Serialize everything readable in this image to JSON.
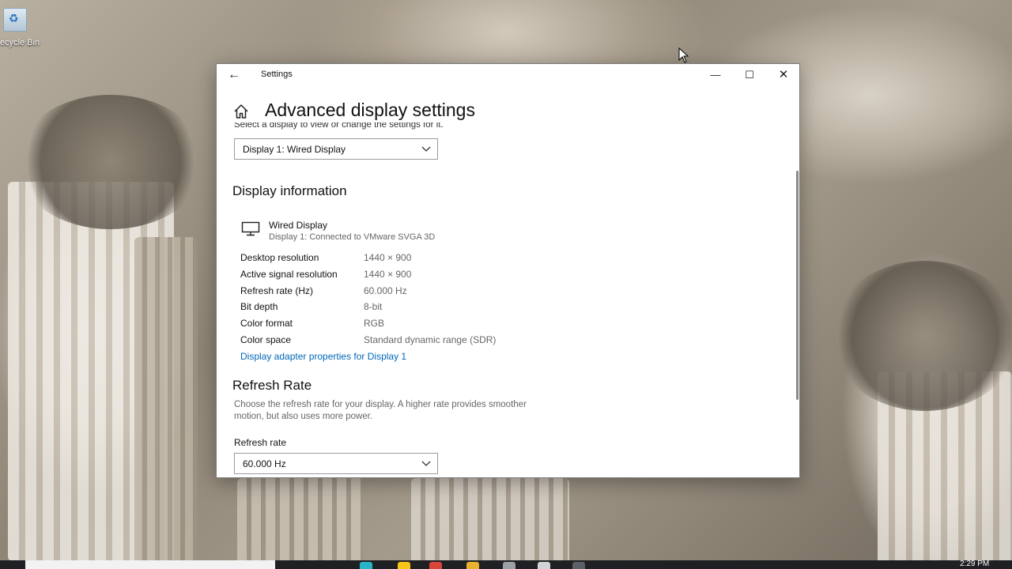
{
  "desktop": {
    "recycle_bin_label": "ecycle Bin"
  },
  "window": {
    "title": "Settings",
    "minimize_glyph": "—",
    "maximize_glyph": "☐",
    "close_glyph": "✕"
  },
  "page": {
    "title": "Advanced display settings",
    "select_prompt": "Select a display to view or change the settings for it.",
    "display_select": {
      "selected": "Display 1: Wired Display"
    }
  },
  "display_info": {
    "heading": "Display information",
    "display_name": "Wired Display",
    "display_subtitle": "Display 1: Connected to VMware SVGA 3D",
    "properties": [
      {
        "label": "Desktop resolution",
        "value": "1440 × 900"
      },
      {
        "label": "Active signal resolution",
        "value": "1440 × 900"
      },
      {
        "label": "Refresh rate (Hz)",
        "value": "60.000 Hz"
      },
      {
        "label": "Bit depth",
        "value": "8-bit"
      },
      {
        "label": "Color format",
        "value": "RGB"
      },
      {
        "label": "Color space",
        "value": "Standard dynamic range (SDR)"
      }
    ],
    "adapter_link": "Display adapter properties for Display 1"
  },
  "refresh": {
    "heading": "Refresh Rate",
    "description": "Choose the refresh rate for your display. A higher rate provides smoother motion, but also uses more power.",
    "label": "Refresh rate",
    "selected": "60.000 Hz"
  },
  "taskbar": {
    "clock": "2:29 PM"
  },
  "colors": {
    "link": "#0067b8",
    "window_bg": "#ffffff",
    "taskbar_bg": "#1f2024"
  }
}
